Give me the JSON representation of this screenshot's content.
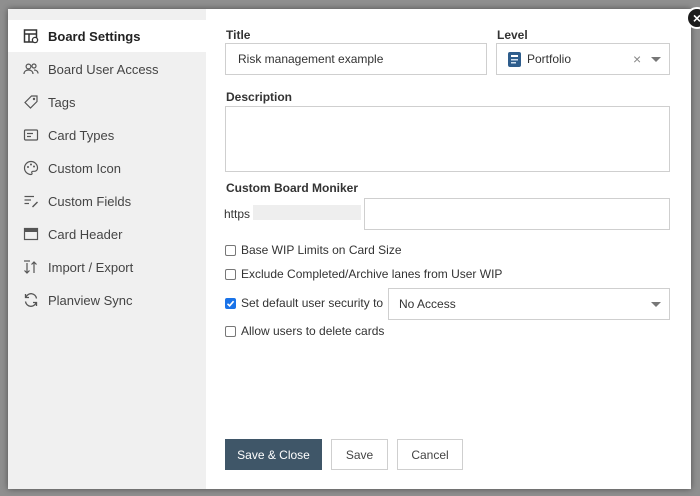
{
  "sidebar": {
    "items": [
      {
        "label": "Board Settings",
        "icon": "board-settings-icon",
        "active": true
      },
      {
        "label": "Board User Access",
        "icon": "users-icon",
        "active": false
      },
      {
        "label": "Tags",
        "icon": "tag-icon",
        "active": false
      },
      {
        "label": "Card Types",
        "icon": "card-types-icon",
        "active": false
      },
      {
        "label": "Custom Icon",
        "icon": "palette-icon",
        "active": false
      },
      {
        "label": "Custom Fields",
        "icon": "custom-fields-icon",
        "active": false
      },
      {
        "label": "Card Header",
        "icon": "card-header-icon",
        "active": false
      },
      {
        "label": "Import / Export",
        "icon": "import-export-icon",
        "active": false
      },
      {
        "label": "Planview Sync",
        "icon": "sync-icon",
        "active": false
      }
    ]
  },
  "form": {
    "title_label": "Title",
    "title_value": "Risk management example",
    "level_label": "Level",
    "level_value": "Portfolio",
    "level_clear": "×",
    "description_label": "Description",
    "description_value": "",
    "moniker_label": "Custom Board Moniker",
    "moniker_prefix": "https",
    "moniker_value": "",
    "checkboxes": [
      {
        "label": "Base WIP Limits on Card Size",
        "checked": false
      },
      {
        "label": "Exclude Completed/Archive lanes from User WIP",
        "checked": false
      },
      {
        "label": "Set default user security to",
        "checked": true
      },
      {
        "label": "Allow users to delete cards",
        "checked": false
      }
    ],
    "security_value": "No Access"
  },
  "buttons": {
    "save_close": "Save & Close",
    "save": "Save",
    "cancel": "Cancel"
  },
  "close_label": "×",
  "colors": {
    "primary_button": "#3f5668",
    "checkbox_checked": "#1a73e8",
    "sidebar_bg": "#f0f0f0",
    "level_icon": "#2e5d8c"
  }
}
